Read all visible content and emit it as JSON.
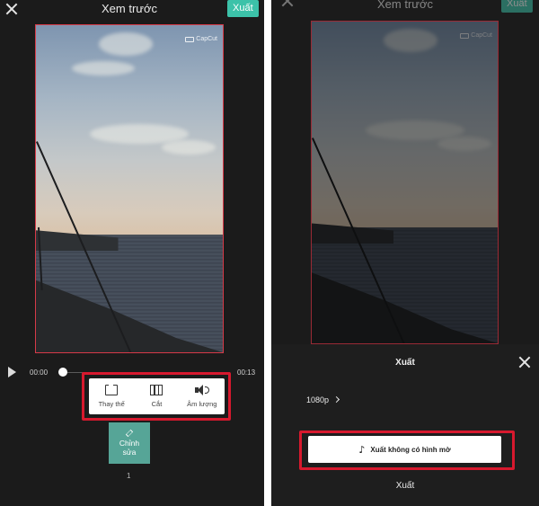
{
  "left": {
    "title": "Xem trước",
    "export_label": "Xuất",
    "time_current": "00:00",
    "time_total": "00:13",
    "progress": 0,
    "tools": [
      {
        "label": "Thay thế",
        "icon": "replace-icon"
      },
      {
        "label": "Cắt",
        "icon": "crop-icon"
      },
      {
        "label": "Âm lượng",
        "icon": "volume-icon"
      }
    ],
    "edit_label_line1": "Chỉnh",
    "edit_label_line2": "sửa",
    "clip_index": "1"
  },
  "watermark": "CapCut",
  "right": {
    "title": "Xem trước",
    "export_label": "Xuất",
    "sheet_title": "Xuất",
    "resolution": "1080p",
    "no_watermark_label": "Xuất không có hình mờ",
    "export_plain_label": "Xuất"
  },
  "colors": {
    "accent": "#3cc2a9",
    "highlight_red": "#d7192e",
    "background": "#1b1b1b"
  }
}
